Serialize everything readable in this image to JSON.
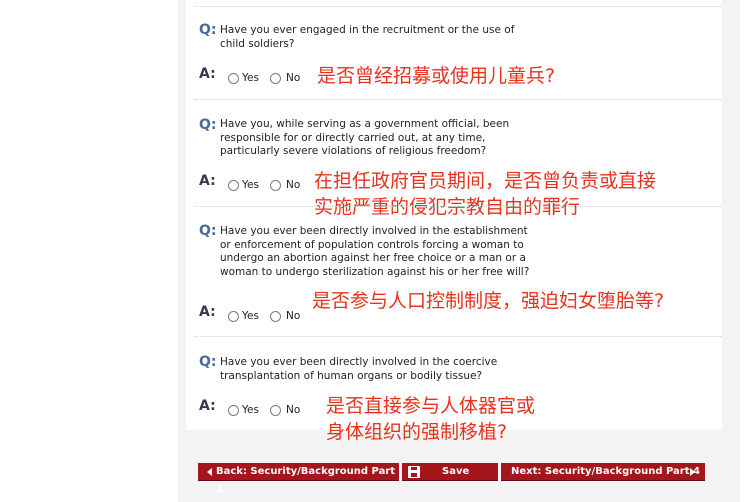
{
  "qa": [
    {
      "q_tag": "Q:",
      "q_lines": [
        "Have you ever engaged in the recruitment or the use of",
        "child soldiers?"
      ],
      "a_tag": "A:",
      "yes": "Yes",
      "no": "No",
      "note_lines": [
        "是否曾经招募或使用儿童兵?"
      ]
    },
    {
      "q_tag": "Q:",
      "q_lines": [
        "Have you, while serving as a government official, been",
        "responsible for or directly carried out, at any time,",
        "particularly severe violations of religious freedom?"
      ],
      "a_tag": "A:",
      "yes": "Yes",
      "no": "No",
      "note_lines": [
        "在担任政府官员期间，是否曾负责或直接",
        "实施严重的侵犯宗教自由的罪行"
      ]
    },
    {
      "q_tag": "Q:",
      "q_lines": [
        "Have you ever been directly involved in the establishment",
        "or enforcement of population controls forcing a woman to",
        "undergo an abortion against her free choice or a man or a",
        "woman to undergo sterilization against his or her free will?"
      ],
      "a_tag": "A:",
      "yes": "Yes",
      "no": "No",
      "note_lines": [
        "是否参与人口控制制度，强迫妇女堕胎等?"
      ]
    },
    {
      "q_tag": "Q:",
      "q_lines": [
        "Have you ever been directly involved in the coercive",
        "transplantation of human organs or bodily tissue?"
      ],
      "a_tag": "A:",
      "yes": "Yes",
      "no": "No",
      "note_lines": [
        "是否直接参与人体器官或",
        "身体组织的强制移植?"
      ]
    }
  ],
  "nav": {
    "back_label": "Back: Security/Background Part 2",
    "save_label": "Save",
    "next_label": "Next: Security/Background Part 4"
  },
  "colors": {
    "button": "#a4161c",
    "question_tag": "#4a6c96",
    "annotation": "#e8321e"
  }
}
